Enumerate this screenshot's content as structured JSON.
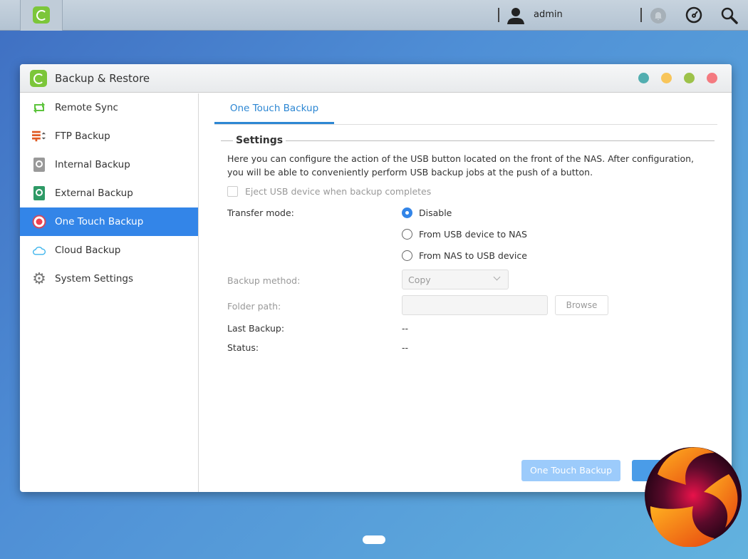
{
  "topbar": {
    "user": "admin",
    "icons": [
      "app-icon",
      "user-icon",
      "bell-icon",
      "dashboard-icon",
      "search-icon"
    ]
  },
  "window": {
    "title": "Backup & Restore",
    "controls": [
      {
        "name": "minimize",
        "color": "#52aeb0"
      },
      {
        "name": "maximize",
        "color": "#f8c55a"
      },
      {
        "name": "restore",
        "color": "#9dc24a"
      },
      {
        "name": "close",
        "color": "#f47a80"
      }
    ]
  },
  "sidebar": {
    "items": [
      {
        "label": "Remote Sync",
        "icon": "sync-icon"
      },
      {
        "label": "FTP Backup",
        "icon": "ftp-icon"
      },
      {
        "label": "Internal Backup",
        "icon": "internal-disk-icon"
      },
      {
        "label": "External Backup",
        "icon": "external-disk-icon"
      },
      {
        "label": "One Touch Backup",
        "icon": "record-icon",
        "active": true
      },
      {
        "label": "Cloud Backup",
        "icon": "cloud-icon"
      },
      {
        "label": "System Settings",
        "icon": "gear-icon"
      }
    ]
  },
  "main": {
    "tab": "One Touch Backup",
    "section": "Settings",
    "description": "Here you can configure the action of the USB button located on the front of the NAS. After configuration, you will be able to conveniently perform USB backup jobs at the push of a button.",
    "eject_label": "Eject USB device when backup completes",
    "eject_checked": false,
    "transfer_mode_label": "Transfer mode:",
    "transfer_options": [
      "Disable",
      "From USB device to NAS",
      "From NAS to USB device"
    ],
    "transfer_selected": "Disable",
    "backup_method_label": "Backup method:",
    "backup_method_value": "Copy",
    "folder_path_label": "Folder path:",
    "folder_path_value": "",
    "browse_label": "Browse",
    "last_backup_label": "Last Backup:",
    "last_backup_value": "--",
    "status_label": "Status:",
    "status_value": "--",
    "one_touch_button": "One Touch Backup"
  },
  "colors": {
    "accent": "#3385e8",
    "tab": "#2d87d3"
  }
}
